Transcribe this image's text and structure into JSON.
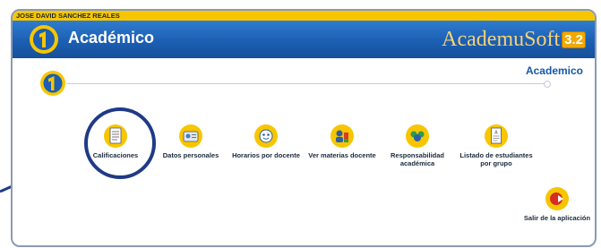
{
  "user": {
    "name": "JOSE DAVID SANCHEZ REALES"
  },
  "header": {
    "title": "Académico",
    "brand_text": "AcademuSoft",
    "brand_version": "3.2"
  },
  "breadcrumb": {
    "label": "Academico"
  },
  "colors": {
    "user_bar": "#f7c600",
    "header_blue": "#1c5fb3",
    "highlight_ring": "#1f3a86",
    "crumb_text": "#1458a8"
  },
  "menu": {
    "calificaciones": {
      "label": "Calificaciones",
      "icon": "notebook-grades-icon"
    },
    "datos_personales": {
      "label": "Datos personales",
      "icon": "id-card-icon"
    },
    "horarios": {
      "label": "Horarios por docente",
      "icon": "schedule-face-icon"
    },
    "materias": {
      "label": "Ver materias docente",
      "icon": "teacher-subjects-icon"
    },
    "responsabilidad": {
      "label": "Responsabilidad académica",
      "icon": "team-responsibility-icon"
    },
    "listado": {
      "label": "Listado de estudiantes por grupo",
      "icon": "student-list-document-icon"
    },
    "salir": {
      "label": "Salir de la aplicación",
      "icon": "exit-icon"
    }
  }
}
